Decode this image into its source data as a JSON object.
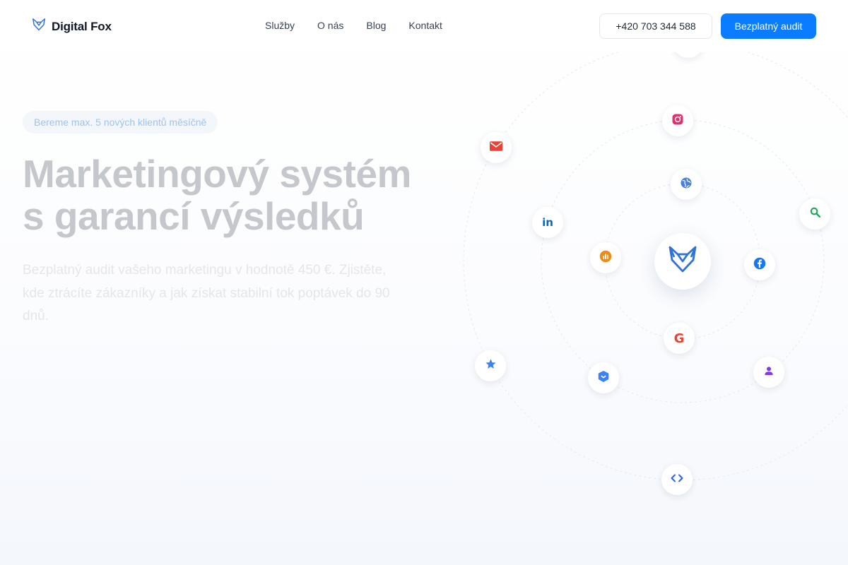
{
  "brand": {
    "name": "Digital Fox",
    "accent": "#0a7cff"
  },
  "nav": {
    "items": [
      "Služby",
      "O nás",
      "Blog",
      "Kontakt"
    ]
  },
  "header": {
    "phone": "+420 703 344 588",
    "cta": "Bezplatný audit"
  },
  "hero": {
    "badge": "Bereme max. 5 nových klientů měsíčně",
    "title_line1": "Marketingový systém",
    "title_line2": "s garancí výsledků",
    "subtitle": "Bezplatný audit vašeho marketingu v hodnotě 450 €. Zjistěte, kde ztrácíte zákazníky a jak získat stabilní tok poptávek do 90 dnů."
  },
  "orbit_icons": [
    "instagram-icon",
    "email-icon",
    "globe-icon",
    "linkedin-icon",
    "search-icon",
    "analytics-icon",
    "facebook-icon",
    "google-icon",
    "star-icon",
    "shield-icon",
    "user-icon",
    "code-icon"
  ],
  "colors": {
    "instagram": "#e1306c",
    "email": "#ea4335",
    "globe": "#4a7fe0",
    "linkedin": "#0a66c2",
    "search": "#22a75a",
    "analytics": "#f08a12",
    "facebook": "#1877f2",
    "star": "#3b82f6",
    "shield": "#3b82f6",
    "user": "#7c3aed",
    "code": "#2563eb"
  }
}
